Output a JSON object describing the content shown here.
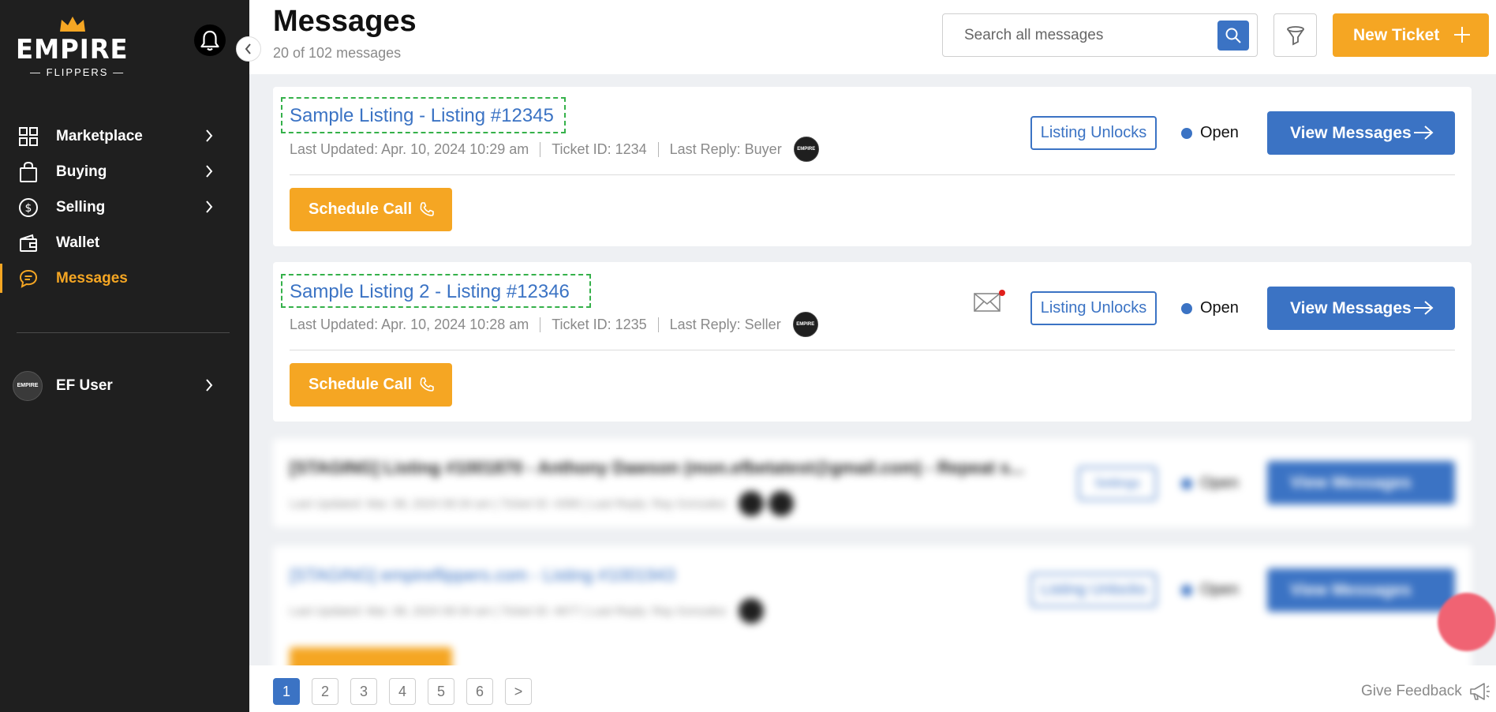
{
  "sidebar": {
    "logo_text": "EMPIRE",
    "logo_subtext": "FLIPPERS",
    "nav": [
      {
        "label": "Marketplace",
        "icon": "grid-icon",
        "chevron": true
      },
      {
        "label": "Buying",
        "icon": "shopping-bag-icon",
        "chevron": true
      },
      {
        "label": "Selling",
        "icon": "dollar-circle-icon",
        "chevron": true
      },
      {
        "label": "Wallet",
        "icon": "wallet-icon",
        "chevron": false
      },
      {
        "label": "Messages",
        "icon": "chat-bubble-icon",
        "chevron": false,
        "active": true
      }
    ],
    "user": {
      "name": "EF User",
      "avatar_text": "EMPIRE"
    }
  },
  "header": {
    "title": "Messages",
    "count": "20 of 102 messages",
    "search_placeholder": "Search all messages",
    "new_ticket_label": "New Ticket"
  },
  "tickets": [
    {
      "title": "Sample Listing - Listing #12345",
      "last_updated": "Last Updated: Apr. 10, 2024 10:29 am",
      "ticket_id": "Ticket ID: 1234",
      "last_reply": "Last Reply: Buyer",
      "tag": "Listing Unlocks",
      "status": "Open",
      "view_label": "View Messages",
      "call_label": "Schedule Call",
      "unread": false
    },
    {
      "title": "Sample Listing 2 - Listing #12346",
      "last_updated": "Last Updated: Apr. 10, 2024 10:28 am",
      "ticket_id": "Ticket ID: 1235",
      "last_reply": "Last Reply: Seller",
      "tag": "Listing Unlocks",
      "status": "Open",
      "view_label": "View Messages",
      "call_label": "Schedule Call",
      "unread": true
    }
  ],
  "blurred_tickets": [
    {
      "title": "[STAGING] Listing #1001870 - Anthony Dawson (mon.efbetatest@gmail.com) - Repeat s...",
      "meta": "Last Updated: Mar. 08, 2024 09:34 am  |  Ticket ID: 4399  |  Last Reply: Ray Gonzalez",
      "tag": "Settings",
      "status": "Open",
      "view_label": "View Messages"
    },
    {
      "title": "[STAGING] empireflippers.com - Listing #1001943",
      "meta": "Last Updated: Mar. 08, 2024 09:34 am  |  Ticket ID: 4677  |  Last Reply: Ray Gonzalez",
      "tag": "Listing Unlocks",
      "status": "Open",
      "view_label": "View Messages"
    }
  ],
  "pagination": {
    "pages": [
      "1",
      "2",
      "3",
      "4",
      "5",
      "6"
    ],
    "current": "1",
    "next_label": ">"
  },
  "feedback_label": "Give Feedback",
  "colors": {
    "sidebar_bg": "#1f1f1f",
    "accent_orange": "#f5a623",
    "primary_blue": "#3b73c4",
    "highlight_dash": "#35b14a",
    "unread_dot": "#e0201b"
  }
}
